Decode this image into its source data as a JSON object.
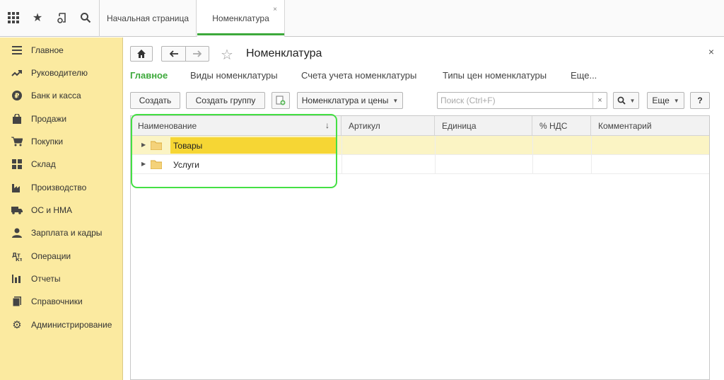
{
  "tabs": [
    {
      "label": "Начальная страница"
    },
    {
      "label": "Номенклатура",
      "close": "×"
    }
  ],
  "sidebar": {
    "items": [
      {
        "label": "Главное",
        "icon": "menu-lines-icon"
      },
      {
        "label": "Руководителю",
        "icon": "trend-chart-icon"
      },
      {
        "label": "Банк и касса",
        "icon": "ruble-coin-icon"
      },
      {
        "label": "Продажи",
        "icon": "shopping-bag-icon"
      },
      {
        "label": "Покупки",
        "icon": "cart-icon"
      },
      {
        "label": "Склад",
        "icon": "warehouse-grid-icon"
      },
      {
        "label": "Производство",
        "icon": "factory-icon"
      },
      {
        "label": "ОС и НМА",
        "icon": "truck-icon"
      },
      {
        "label": "Зарплата и кадры",
        "icon": "person-icon"
      },
      {
        "label": "Операции",
        "icon": "operations-icon"
      },
      {
        "label": "Отчеты",
        "icon": "bar-chart-icon"
      },
      {
        "label": "Справочники",
        "icon": "books-icon"
      },
      {
        "label": "Администрирование",
        "icon": "gear-icon"
      }
    ]
  },
  "form": {
    "title": "Номенклатура",
    "close": "×"
  },
  "links": [
    {
      "label": "Главное"
    },
    {
      "label": "Виды номенклатуры"
    },
    {
      "label": "Счета учета номенклатуры"
    },
    {
      "label": "Типы цен номенклатуры"
    },
    {
      "label": "Еще..."
    }
  ],
  "toolbar": {
    "create": "Создать",
    "create_group": "Создать группу",
    "prices": "Номенклатура и цены",
    "search_placeholder": "Поиск (Ctrl+F)",
    "clear": "×",
    "more": "Еще",
    "help": "?"
  },
  "table": {
    "columns": [
      "Наименование",
      "Артикул",
      "Единица",
      "% НДС",
      "Комментарий"
    ],
    "sort_indicator": "↓",
    "rows": [
      {
        "name": "Товары",
        "selected": true
      },
      {
        "name": "Услуги",
        "selected": false
      }
    ]
  },
  "colors": {
    "accent_green": "#3da93b",
    "sidebar_bg": "#fbeaa0",
    "selection_yellow": "#f6d634",
    "highlight_green": "#44e044"
  }
}
